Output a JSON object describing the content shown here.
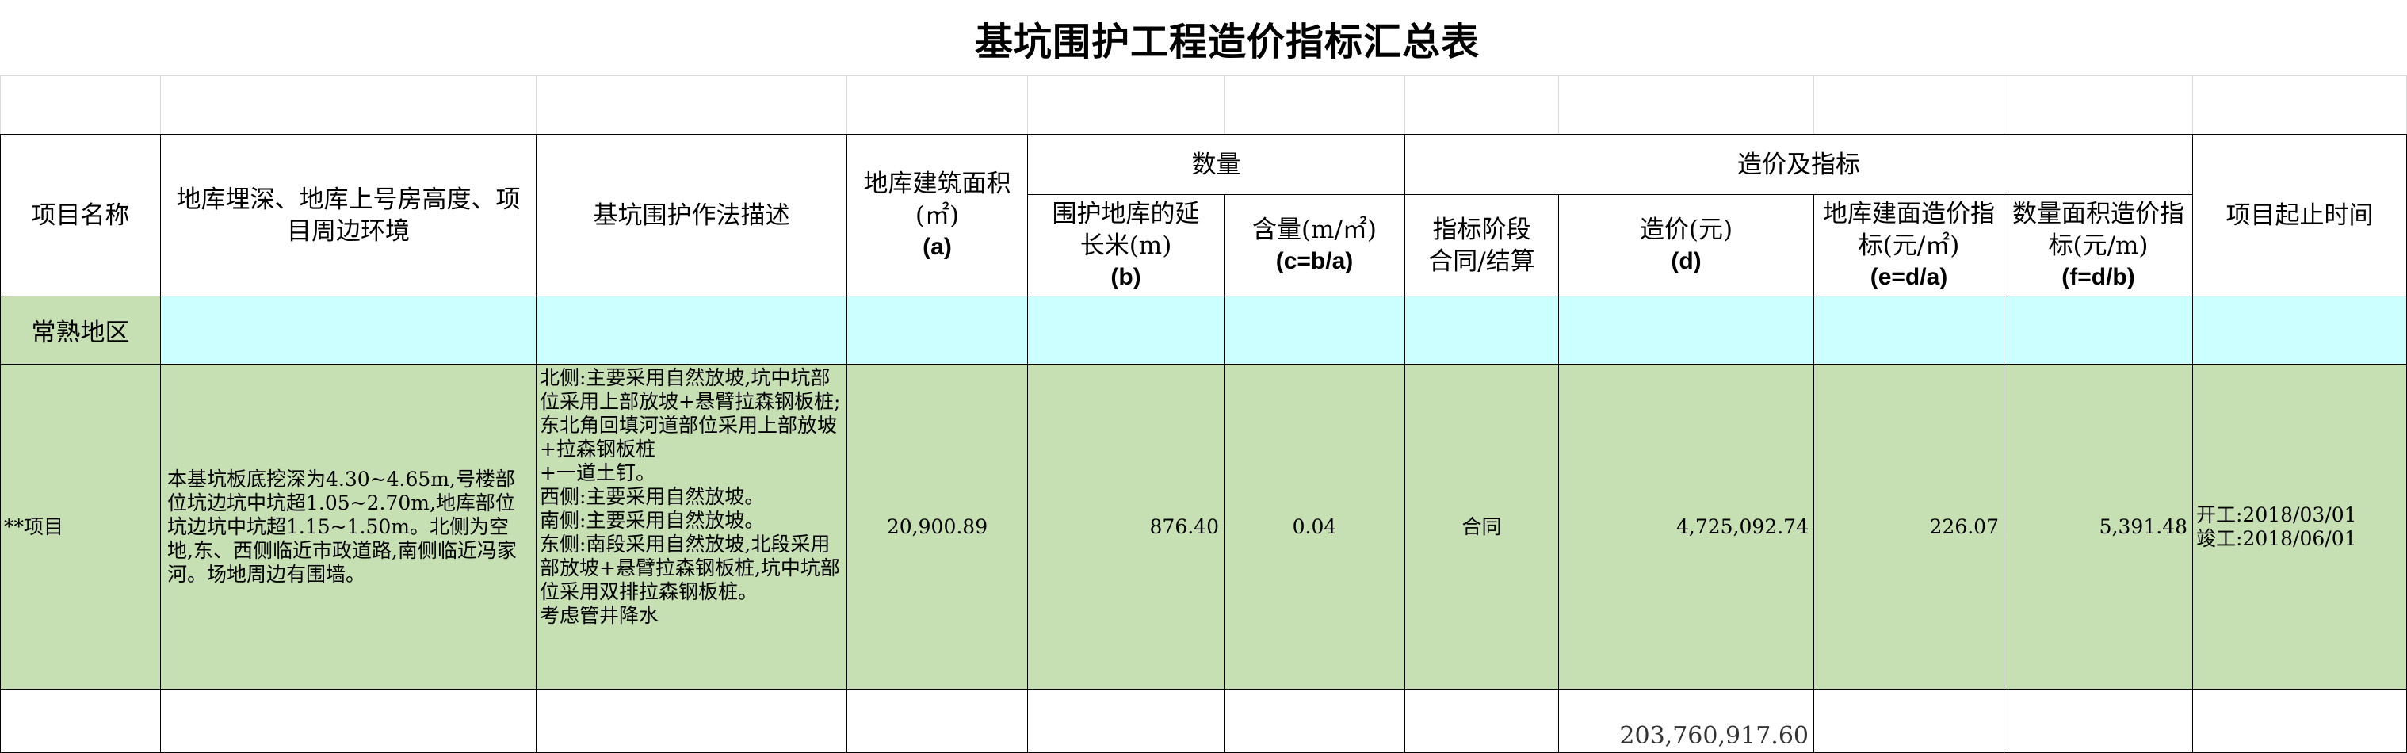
{
  "title": "基坑围护工程造价指标汇总表",
  "headers": {
    "project_name": "项目名称",
    "env": "地库埋深、地库上号房高度、项目周边环境",
    "method": "基坑围护作法描述",
    "area_cn": "地库建筑面积(㎡)",
    "area_fx": "(a)",
    "quantity_group": "数量",
    "length_cn": "围护地库的延长米(m)",
    "length_fx": "(b)",
    "content_cn": "含量(m/㎡)",
    "content_fx": "(c=b/a)",
    "cost_group": "造价及指标",
    "stage_cn": "指标阶段",
    "stage_sub": "合同/结算",
    "cost_cn": "造价(元)",
    "cost_fx": "(d)",
    "area_index_cn": "地库建面造价指标(元/㎡)",
    "area_index_fx": "(e=d/a)",
    "length_index_cn": "数量面积造价指标(元/m)",
    "length_index_fx": "(f=d/b)",
    "period": "项目起止时间"
  },
  "region": {
    "label": "常熟地区"
  },
  "row": {
    "project_name": "**项目",
    "env": "本基坑板底挖深为4.30~4.65m,号楼部位坑边坑中坑超1.05~2.70m,地库部位坑边坑中坑超1.15~1.50m。北侧为空地,东、西侧临近市政道路,南侧临近冯家河。场地周边有围墙。",
    "method_lines": [
      "北侧:主要采用自然放坡,坑中坑部位采用上部放坡+悬臂拉森钢板桩;东北角回填河道部位采用上部放坡+拉森钢板桩",
      "+一道土钉。",
      "西侧:主要采用自然放坡。",
      "南侧:主要采用自然放坡。",
      "东侧:南段采用自然放坡,北段采用部放坡+悬臂拉森钢板桩,坑中坑部位采用双排拉森钢板桩。",
      "考虑管井降水"
    ],
    "area": "20,900.89",
    "length": "876.40",
    "content": "0.04",
    "stage": "合同",
    "cost": "4,725,092.74",
    "area_index": "226.07",
    "length_index": "5,391.48",
    "start": "开工:2018/03/01",
    "end": "竣工:2018/06/01"
  },
  "total": {
    "cost": "203,760,917.60"
  }
}
